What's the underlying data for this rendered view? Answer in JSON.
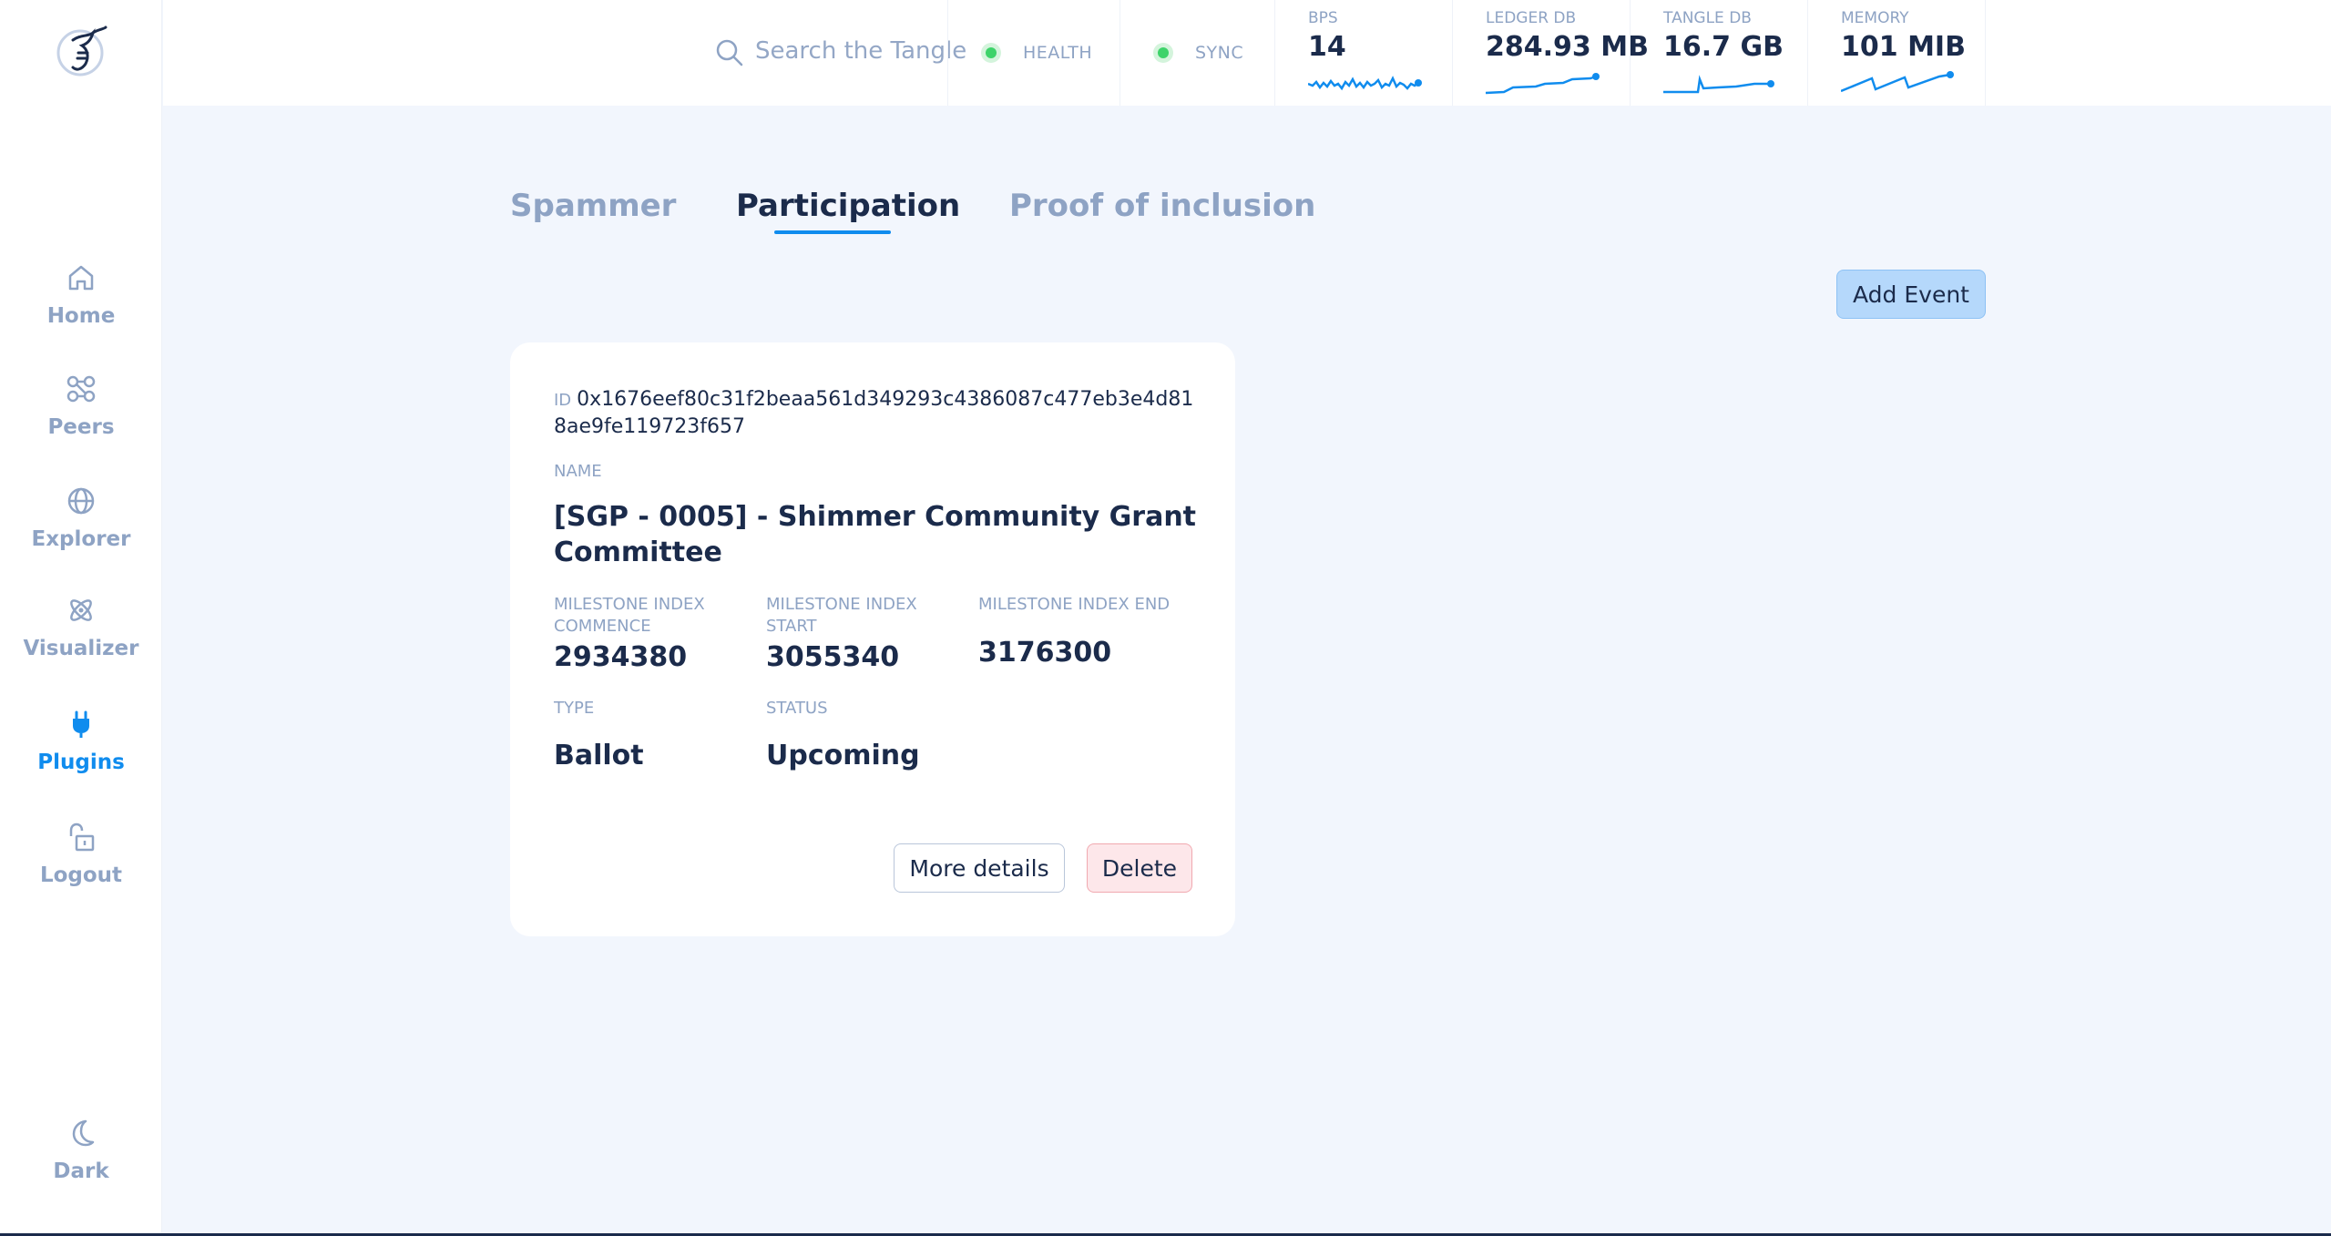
{
  "search": {
    "placeholder": "Search the Tangle"
  },
  "status": {
    "health": "HEALTH",
    "sync": "SYNC"
  },
  "metrics": [
    {
      "label": "BPS",
      "value": "14"
    },
    {
      "label": "LEDGER DB",
      "value": "284.93 MB"
    },
    {
      "label": "TANGLE DB",
      "value": "16.7 GB"
    },
    {
      "label": "MEMORY",
      "value": "101 MIB"
    }
  ],
  "sidebar": {
    "items": [
      {
        "label": "Home",
        "icon": "home-icon"
      },
      {
        "label": "Peers",
        "icon": "peers-icon"
      },
      {
        "label": "Explorer",
        "icon": "globe-icon"
      },
      {
        "label": "Visualizer",
        "icon": "atom-icon"
      },
      {
        "label": "Plugins",
        "icon": "plug-icon",
        "active": true
      },
      {
        "label": "Logout",
        "icon": "unlock-icon"
      }
    ],
    "theme_toggle": {
      "label": "Dark",
      "icon": "moon-icon"
    }
  },
  "tabs": [
    {
      "label": "Spammer"
    },
    {
      "label": "Participation",
      "active": true
    },
    {
      "label": "Proof of inclusion"
    }
  ],
  "add_event_label": "Add Event",
  "event": {
    "id_label": "ID",
    "id": "0x1676eef80c31f2beaa561d349293c4386087c477eb3e4d818ae9fe119723f657",
    "name_label": "NAME",
    "name": "[SGP - 0005] - Shimmer Community Grant Committee",
    "commence_label": "MILESTONE INDEX COMMENCE",
    "commence": "2934380",
    "start_label": "MILESTONE INDEX START",
    "start": "3055340",
    "end_label": "MILESTONE INDEX END",
    "end": "3176300",
    "type_label": "TYPE",
    "type": "Ballot",
    "status_label": "STATUS",
    "status": "Upcoming",
    "details_label": "More details",
    "delete_label": "Delete"
  },
  "colors": {
    "accent": "#108cee",
    "text": "#1b2b4b",
    "muted": "#8ea3c4",
    "background": "#f2f6fd",
    "health_ok": "#3ed36a"
  }
}
